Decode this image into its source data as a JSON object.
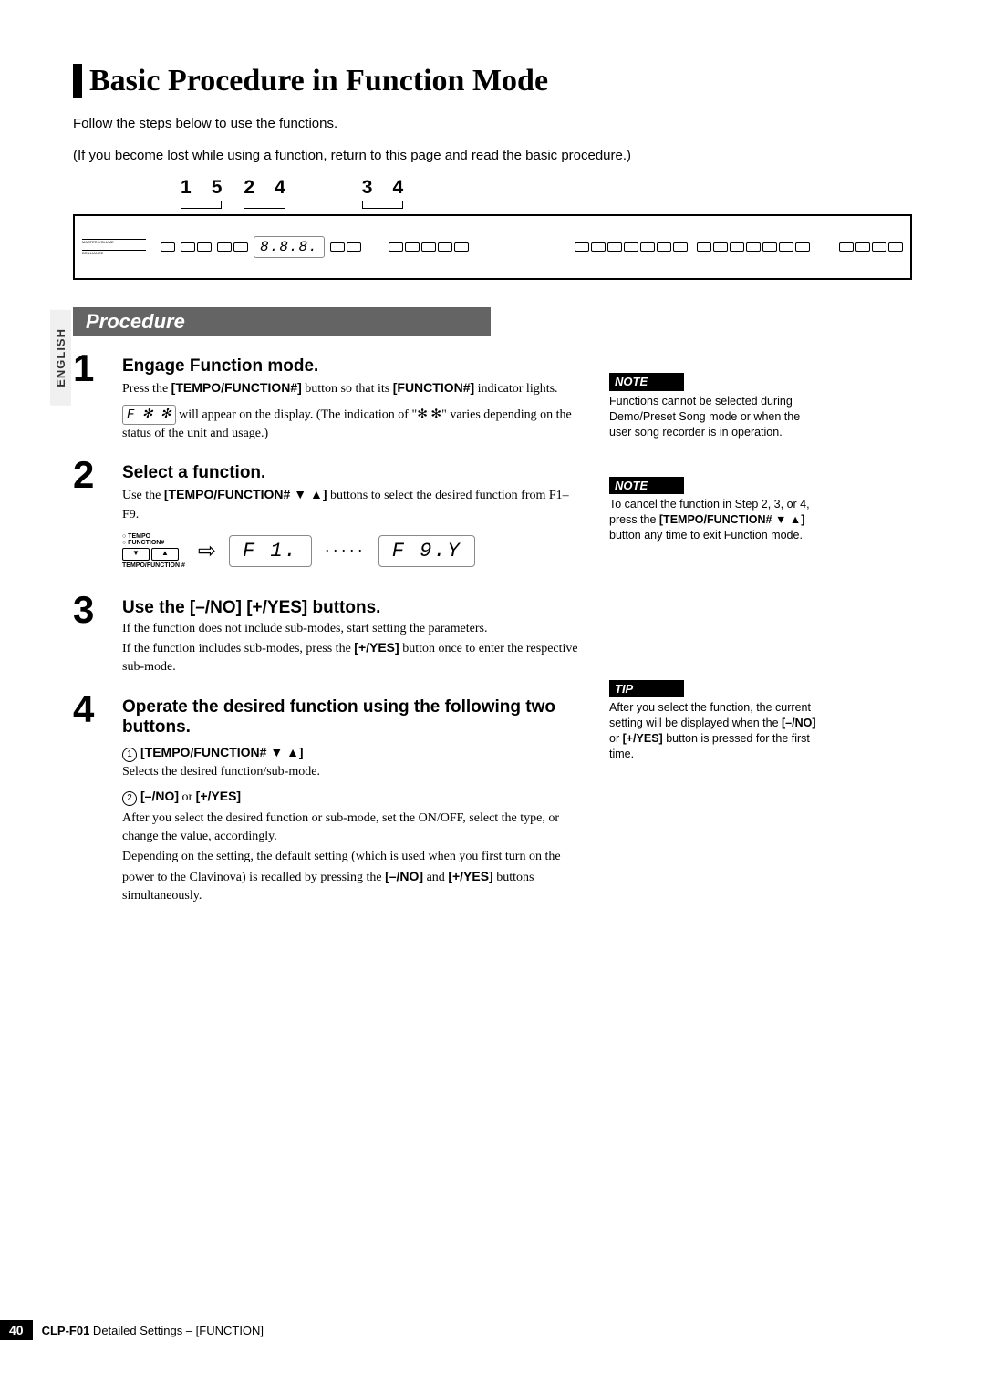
{
  "sideTab": "ENGLISH",
  "title": "Basic Procedure in Function Mode",
  "intro1": "Follow the steps below to use the functions.",
  "intro2": "(If you become lost while using a function, return to this page and read the basic procedure.)",
  "calloutGroups": {
    "g1a": "1",
    "g1b": "5",
    "g2a": "2",
    "g2b": "4",
    "g3a": "3",
    "g3b": "4"
  },
  "panelDigits": "8.8.8.",
  "procedureBanner": "Procedure",
  "steps": {
    "s1": {
      "num": "1",
      "title": "Engage Function mode.",
      "p1a": "Press the ",
      "p1b": "[TEMPO/FUNCTION#]",
      "p1c": " button so that its ",
      "p1d": "[FUNCTION#]",
      "p1e": " indicator lights.",
      "box": "F ✻ ✻",
      "p2a": " will appear on the display. (The indication of \"",
      "p2b": "✻ ✻",
      "p2c": "\" varies depending on the status of the unit and usage.)"
    },
    "s2": {
      "num": "2",
      "title": "Select a function.",
      "p1a": "Use the ",
      "p1b": "[TEMPO/FUNCTION# ▼ ▲]",
      "p1c": " buttons to select the desired function from F1–F9.",
      "tfLabel1": "○ TEMPO",
      "tfLabel2": "○ FUNCTION#",
      "tfCaption": "TEMPO/FUNCTION #",
      "disp1": "F  1.",
      "dots": "·····",
      "disp2": "F 9.Y"
    },
    "s3": {
      "num": "3",
      "title": "Use the [–/NO] [+/YES] buttons.",
      "p1": "If the function does not include sub-modes, start setting the parameters.",
      "p2a": "If the function includes sub-modes, press the ",
      "p2b": "[+/YES]",
      "p2c": " button once to enter the respective sub-mode."
    },
    "s4": {
      "num": "4",
      "title": "Operate the desired function using the following two buttons.",
      "i1n": "1",
      "i1a": "[TEMPO/FUNCTION# ▼ ▲]",
      "i1b": "Selects the desired function/sub-mode.",
      "i2n": "2",
      "i2a": "[–/NO]",
      "i2b": " or ",
      "i2c": "[+/YES]",
      "i2p1": "After you select the desired function or sub-mode, set the ON/OFF, select the type, or change the value, accordingly.",
      "i2p2a": "Depending on the setting, the default setting (which is used when you first turn on the power to the Clavinova) is recalled by pressing the ",
      "i2p2b": "[–/NO]",
      "i2p2c": " and ",
      "i2p2d": "[+/YES]",
      "i2p2e": " buttons simultaneously."
    }
  },
  "notes": {
    "n1head": "NOTE",
    "n1": "Functions cannot be selected during Demo/Preset Song mode or when the user song recorder is in operation.",
    "n2head": "NOTE",
    "n2a": "To cancel the function in Step 2, 3, or 4, press the ",
    "n2b": "[TEMPO/FUNCTION# ▼ ▲]",
    "n2c": " button any time to exit Function mode.",
    "t1head": "TIP",
    "t1a": "After you select the function, the current setting will be displayed when the ",
    "t1b": "[–/NO]",
    "t1c": " or ",
    "t1d": "[+/YES]",
    "t1e": " button is pressed for the first time."
  },
  "footer": {
    "page": "40",
    "model": "CLP-F01",
    "rest": "   Detailed Settings – [FUNCTION]"
  }
}
